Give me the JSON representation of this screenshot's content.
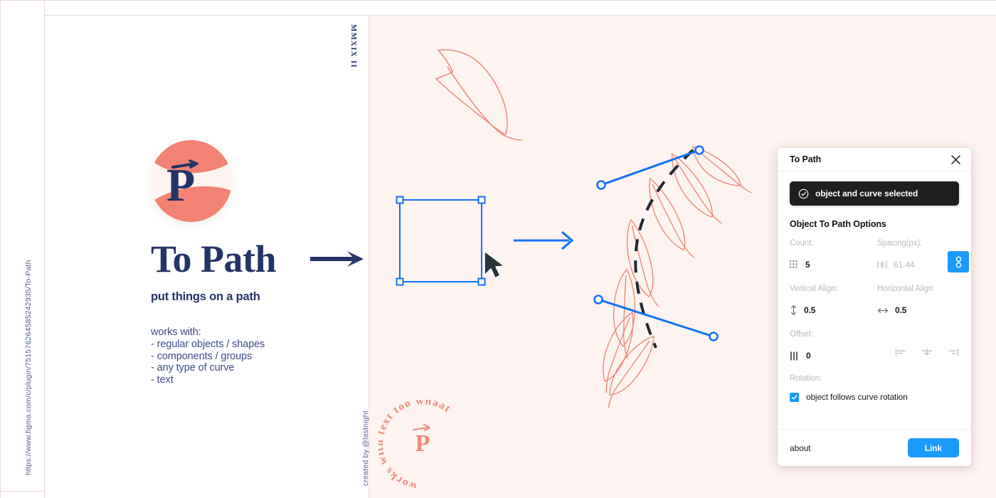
{
  "page": {
    "url_text": "https://www.figma.com/c/plugin/751576264585242935/To-Path",
    "edition_mark": "MMXIX II",
    "credit": "created by @lastnight"
  },
  "hero": {
    "title": "To Path",
    "subtitle": "put things on a path",
    "works_with_heading": "works with:",
    "works_with_items": [
      "- regular objects / shapes",
      "- components / groups",
      "- any type of curve",
      "- text"
    ],
    "logo_letter": "P"
  },
  "stamp": {
    "text": "works with text too whaat",
    "letter": "P"
  },
  "plugin": {
    "title": "To Path",
    "close_icon": "close-icon",
    "toast": {
      "icon": "check-circle-icon",
      "message": "object and curve selected"
    },
    "section_title": "Object To Path Options",
    "fields": {
      "count": {
        "label": "Count:",
        "icon": "grid-dots-icon",
        "value": "5"
      },
      "spacing": {
        "label": "Spacing(px):",
        "icon": "horizontal-spacing-icon",
        "value": "61.44"
      },
      "link_toggle": {
        "icon": "link-chain-icon",
        "active": true,
        "color": "#1a9bfc"
      },
      "vertical_align": {
        "label": "Vertical Align:",
        "icon": "vertical-arrow-icon",
        "value": "0.5"
      },
      "horizontal_align": {
        "label": "Horizontal Align",
        "icon": "horizontal-arrow-icon",
        "value": "0.5"
      },
      "offset": {
        "label": "Offset:",
        "icon": "bars-icon",
        "value": "0"
      },
      "align_buttons": [
        "align-left-icon",
        "align-center-icon",
        "align-right-icon"
      ],
      "rotation": {
        "label": "Rotation:"
      },
      "follow_rotation": {
        "label": "object follows curve rotation",
        "checked": true
      }
    },
    "footer": {
      "about_label": "about",
      "primary_label": "Link"
    }
  },
  "colors": {
    "navy": "#243468",
    "coral": "#f28272",
    "accent_blue": "#1a9bfc",
    "canvas_pink": "#fdf3f0",
    "toast_bg": "#1f1f1f"
  }
}
